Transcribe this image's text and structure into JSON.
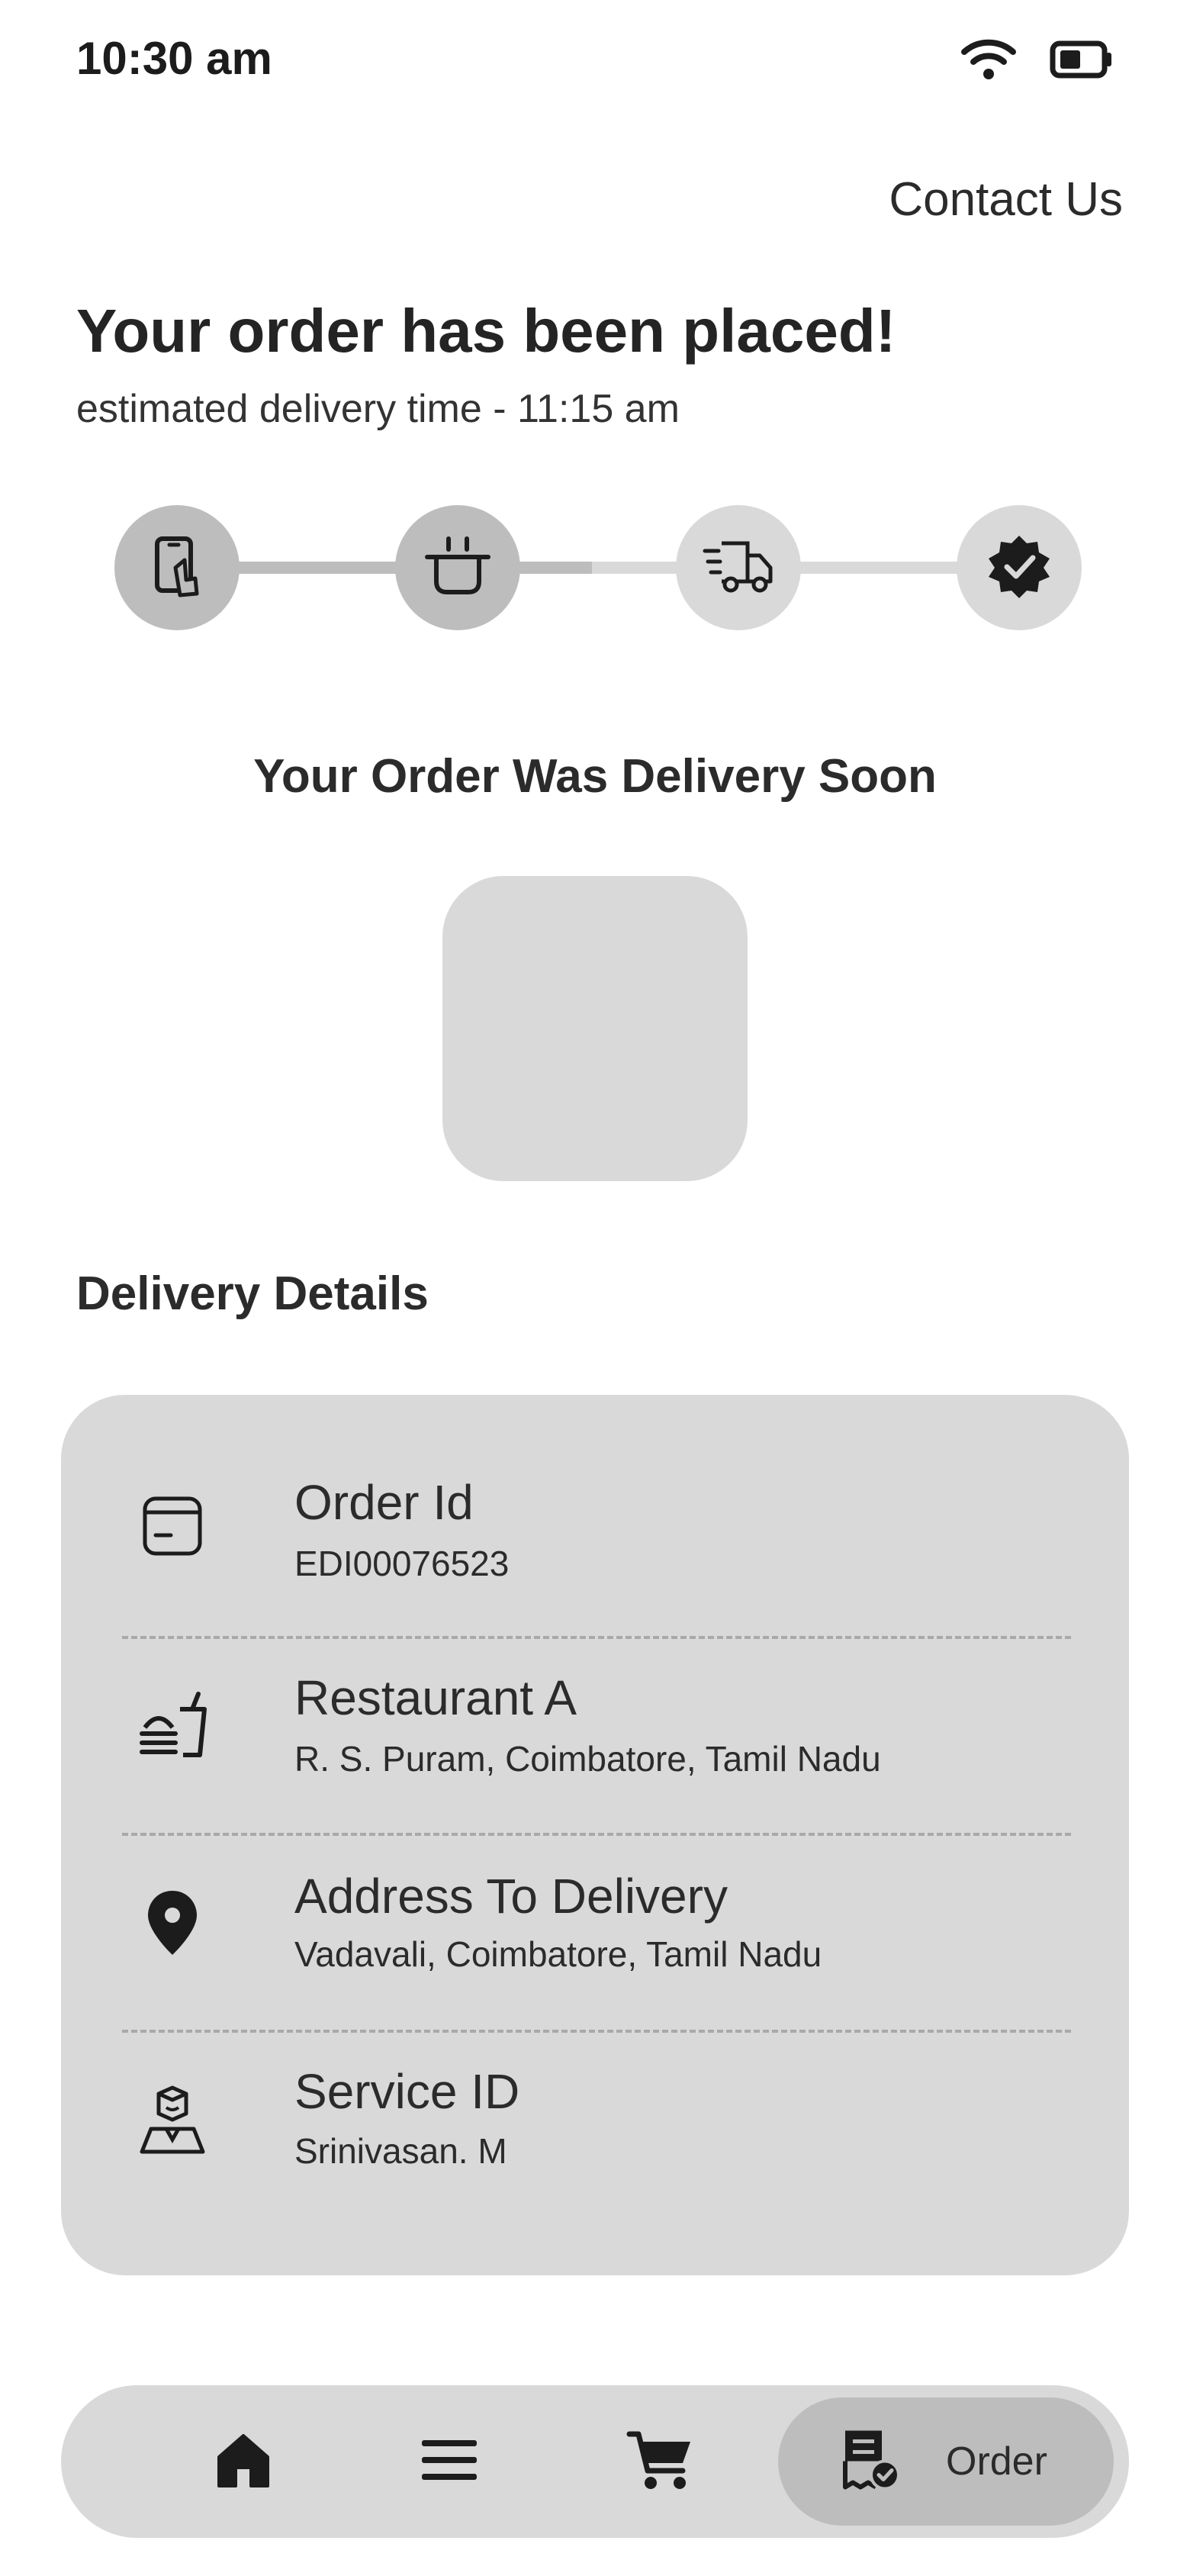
{
  "status_bar": {
    "time": "10:30 am",
    "wifi_icon": "wifi-icon",
    "battery_icon": "battery-icon"
  },
  "header": {
    "contact_label": "Contact Us"
  },
  "order_status": {
    "title": "Your order has been placed!",
    "estimate": "estimated delivery time - 11:15 am",
    "progress": {
      "steps": [
        {
          "icon": "phone-order-icon",
          "state": "done"
        },
        {
          "icon": "cooking-pot-icon",
          "state": "done"
        },
        {
          "icon": "delivery-truck-icon",
          "state": "pending"
        },
        {
          "icon": "verified-badge-icon",
          "state": "pending"
        }
      ],
      "completed_fraction": 0.5
    },
    "message": "Your Order Was Delivery Soon"
  },
  "delivery_details": {
    "title": "Delivery Details",
    "items": [
      {
        "icon": "card-icon",
        "label": "Order Id",
        "value": "EDI00076523"
      },
      {
        "icon": "restaurant-icon",
        "label": "Restaurant A",
        "value": "R. S. Puram, Coimbatore, Tamil Nadu"
      },
      {
        "icon": "location-pin-icon",
        "label": "Address To Delivery",
        "value": "Vadavali, Coimbatore, Tamil Nadu"
      },
      {
        "icon": "delivery-person-icon",
        "label": "Service ID",
        "value": "Srinivasan. M"
      }
    ]
  },
  "bottom_nav": {
    "items": [
      {
        "icon": "home-icon"
      },
      {
        "icon": "menu-icon"
      },
      {
        "icon": "cart-icon"
      },
      {
        "icon": "order-receipt-icon",
        "label": "Order",
        "active": true
      }
    ]
  },
  "colors": {
    "background": "#ffffff",
    "surface": "#d9d9d9",
    "active": "#bdbdbd",
    "text": "#2b2b2b"
  }
}
